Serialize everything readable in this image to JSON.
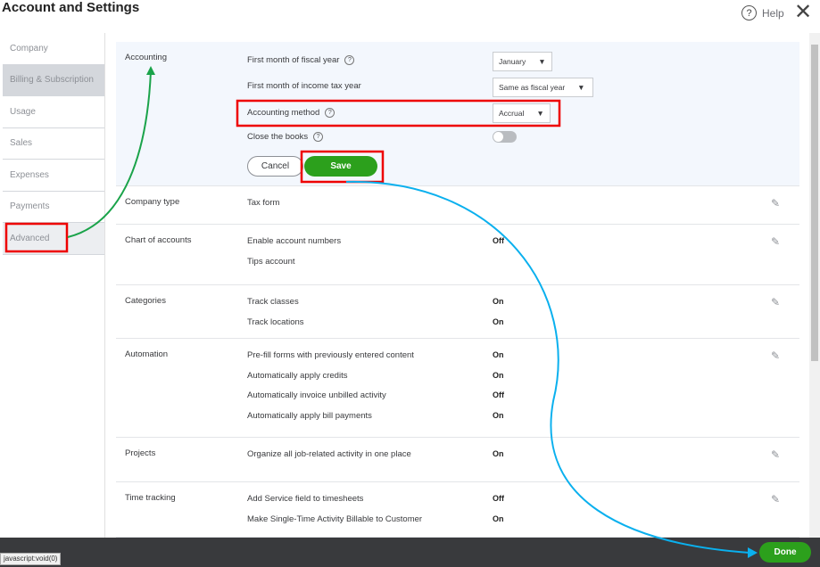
{
  "title": "Account and Settings",
  "help": "Help",
  "sidebar": [
    "Company",
    "Billing & Subscription",
    "Usage",
    "Sales",
    "Expenses",
    "Payments",
    "Advanced"
  ],
  "accounting": {
    "name": "Accounting",
    "fiscal_label": "First month of fiscal year",
    "fiscal_value": "January",
    "tax_label": "First month of income tax year",
    "tax_value": "Same as fiscal year",
    "method_label": "Accounting method",
    "method_value": "Accrual",
    "close_label": "Close the books",
    "close_on": false,
    "cancel": "Cancel",
    "save": "Save"
  },
  "sections": [
    {
      "name": "Company type",
      "rows": [
        {
          "label": "Tax form",
          "value": ""
        }
      ]
    },
    {
      "name": "Chart of accounts",
      "rows": [
        {
          "label": "Enable account numbers",
          "value": "Off"
        },
        {
          "label": "Tips account",
          "value": ""
        }
      ]
    },
    {
      "name": "Categories",
      "rows": [
        {
          "label": "Track classes",
          "value": "On"
        },
        {
          "label": "Track locations",
          "value": "On"
        }
      ]
    },
    {
      "name": "Automation",
      "rows": [
        {
          "label": "Pre-fill forms with previously entered content",
          "value": "On"
        },
        {
          "label": "Automatically apply credits",
          "value": "On"
        },
        {
          "label": "Automatically invoice unbilled activity",
          "value": "Off"
        },
        {
          "label": "Automatically apply bill payments",
          "value": "On"
        }
      ]
    },
    {
      "name": "Projects",
      "rows": [
        {
          "label": "Organize all job-related activity in one place",
          "value": "On"
        }
      ]
    },
    {
      "name": "Time tracking",
      "rows": [
        {
          "label": "Add Service field to timesheets",
          "value": "Off"
        },
        {
          "label": "Make Single-Time Activity Billable to Customer",
          "value": "On"
        }
      ]
    }
  ],
  "done": "Done",
  "status": "javascript:void(0)"
}
